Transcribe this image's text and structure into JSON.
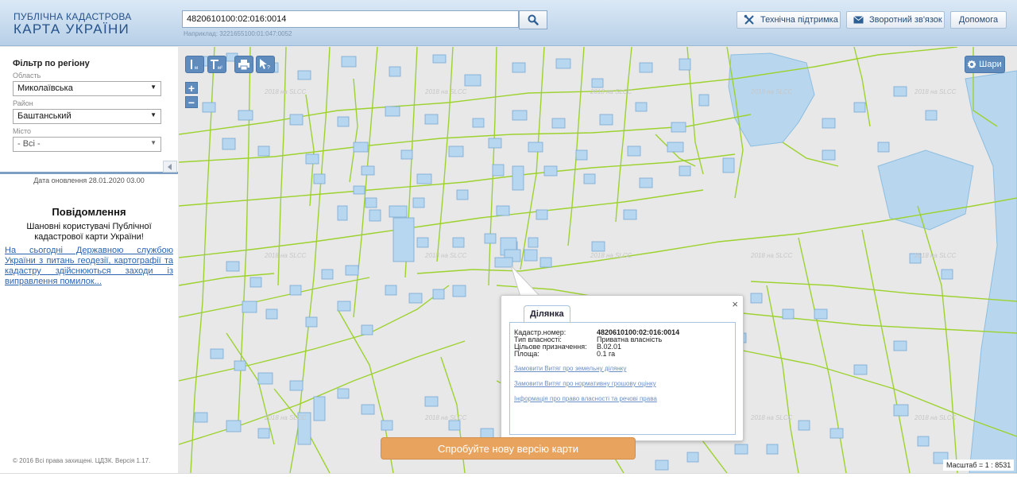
{
  "header": {
    "logo_line1": "ПУБЛІЧНА КАДАСТРОВА",
    "logo_line2": "КАРТА УКРАЇНИ",
    "search_value": "4820610100:02:016:0014",
    "search_hint": "Наприклад: 3221655100:01:047:0052",
    "support_label": "Технічна підтримка",
    "feedback_label": "Зворотний зв'язок",
    "help_label": "Допомога"
  },
  "sidebar": {
    "filter_title": "Фільтр по регіону",
    "region_label": "Область",
    "region_value": "Миколаївська",
    "district_label": "Район",
    "district_value": "Баштанський",
    "city_label": "Місто",
    "city_value": "- Всі -",
    "update_date": "Дата оновлення  28.01.2020 03.00",
    "notice_title": "Повідомлення",
    "notice_text": "Шановні користувачі Публічної кадастрової карти України!",
    "notice_link": "На сьогодні Державною службою України з питань геодезії, картографії та кадастру здійснюються заходи із виправлення помилок...",
    "copyright": "© 2016 Всі права захищені. ЦДЗК. Версія 1.17."
  },
  "map": {
    "layers_label": "Шари",
    "zoom_in": "+",
    "zoom_out": "−",
    "new_version": "Спробуйте нову версію карти",
    "scale": "Масштаб = 1 : 8531",
    "watermark": "2018 на SLCC",
    "colors": {
      "parcel_line": "#9dd22e",
      "building_fill": "#b7d6ef",
      "building_stroke": "#7aa9d3",
      "water": "#b8d7ee"
    }
  },
  "popup": {
    "tab_label": "Ділянка",
    "close": "×",
    "fields": [
      {
        "key": "Кадастр.номер:",
        "value": "4820610100:02:016:0014",
        "bold": true
      },
      {
        "key": "Тип власності:",
        "value": "Приватна власність",
        "bold": false
      },
      {
        "key": "Цільове призначення:",
        "value": "В.02.01",
        "bold": false
      },
      {
        "key": "Площа:",
        "value": "0.1 га",
        "bold": false
      }
    ],
    "links": [
      "Замовити Витяг про земельну ділянку",
      "Замовити Витяг про нормативну грошову оцінку",
      "Інформація про право власності та речові права"
    ]
  }
}
